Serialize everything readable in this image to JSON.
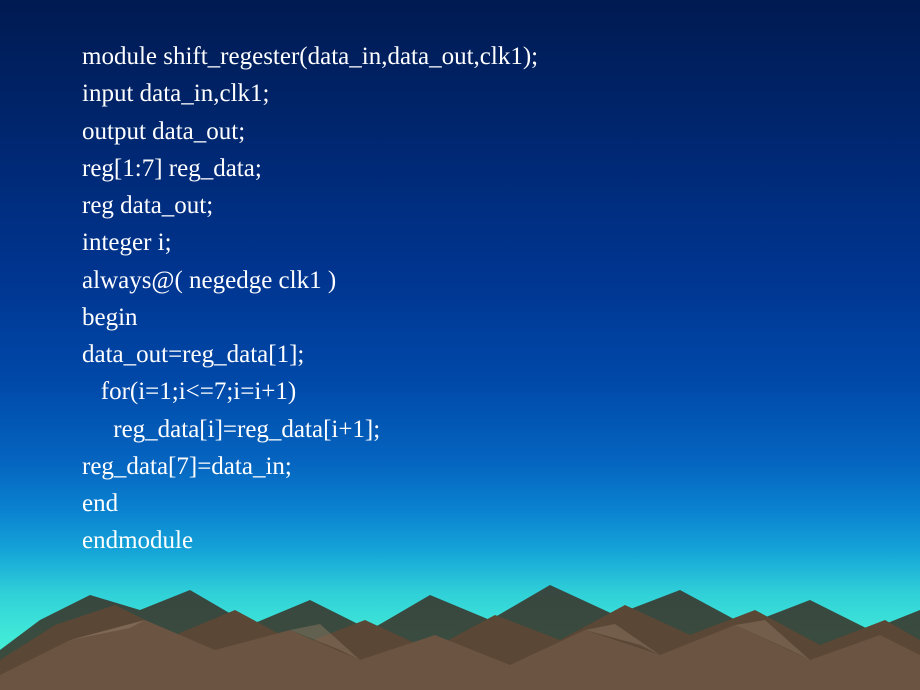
{
  "code": {
    "line1": "module shift_regester(data_in,data_out,clk1);",
    "line2": "input data_in,clk1;",
    "line3": "output data_out;",
    "line4": "reg[1:7] reg_data;",
    "line5": "reg data_out;",
    "line6": "integer i;",
    "line7": "always@( negedge clk1 )",
    "line8": "begin",
    "line9": "data_out=reg_data[1];",
    "line10": "   for(i=1;i<=7;i=i+1)",
    "line11": "     reg_data[i]=reg_data[i+1];",
    "line12": "reg_data[7]=data_in;",
    "line13": "end",
    "line14": "endmodule"
  }
}
